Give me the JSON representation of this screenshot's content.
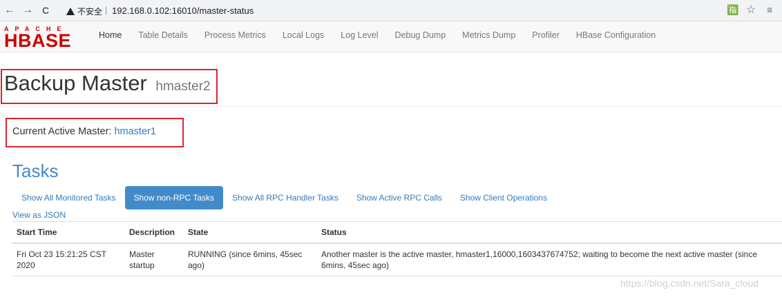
{
  "browser": {
    "back_icon": "←",
    "forward_icon": "→",
    "reload_icon": "C",
    "security_label": "不安全",
    "separator": "|",
    "url": "192.168.0.102:16010/master-status",
    "translate_icon": "🈯",
    "star_icon": "☆",
    "menu_icon": "≡"
  },
  "logo": {
    "apache": "APACHE",
    "hbase": "HBASE"
  },
  "nav": {
    "items": [
      {
        "label": "Home"
      },
      {
        "label": "Table Details"
      },
      {
        "label": "Process Metrics"
      },
      {
        "label": "Local Logs"
      },
      {
        "label": "Log Level"
      },
      {
        "label": "Debug Dump"
      },
      {
        "label": "Metrics Dump"
      },
      {
        "label": "Profiler"
      },
      {
        "label": "HBase Configuration"
      }
    ]
  },
  "header": {
    "title": "Backup Master",
    "subtitle": "hmaster2"
  },
  "active_master": {
    "label": "Current Active Master: ",
    "host": "hmaster1"
  },
  "tasks": {
    "heading": "Tasks",
    "tabs": [
      {
        "label": "Show All Monitored Tasks"
      },
      {
        "label": "Show non-RPC Tasks"
      },
      {
        "label": "Show All RPC Handler Tasks"
      },
      {
        "label": "Show Active RPC Calls"
      },
      {
        "label": "Show Client Operations"
      }
    ],
    "json_link": "View as JSON",
    "columns": [
      "Start Time",
      "Description",
      "State",
      "Status"
    ],
    "rows": [
      {
        "start_time": "Fri Oct 23 15:21:25 CST 2020",
        "description": "Master startup",
        "state": "RUNNING (since 6mins, 45sec ago)",
        "status": "Another master is the active master, hmaster1,16000,1603437674752; waiting to become the next active master (since 6mins, 45sec ago)"
      }
    ]
  },
  "watermark": "https://blog.csdn.net/Sara_cloud"
}
